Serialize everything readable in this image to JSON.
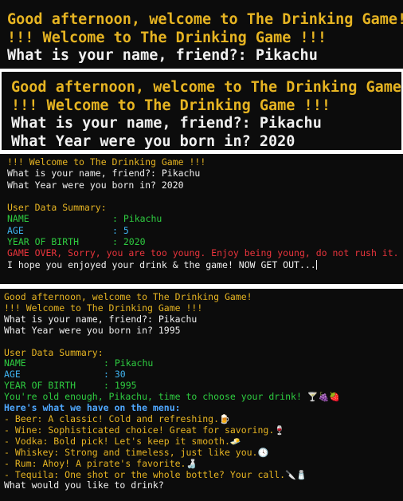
{
  "panel1": {
    "greeting": "Good afternoon, welcome to The Drinking Game!",
    "welcome": "!!! Welcome to The Drinking Game !!!",
    "name_prompt": "What is your name, friend?: Pikachu"
  },
  "panel2": {
    "greeting": "Good afternoon, welcome to The Drinking Game!",
    "welcome": "!!! Welcome to The Drinking Game !!!",
    "name_prompt": "What is your name, friend?: Pikachu",
    "year_prompt": "What Year were you born in? 2020"
  },
  "panel3": {
    "welcome": "!!! Welcome to The Drinking Game !!!",
    "name_prompt": "What is your name, friend?: Pikachu",
    "year_prompt": "What Year were you born in? 2020",
    "summary_title": "User Data Summary:",
    "name_label": "NAME",
    "name_value": ": Pikachu",
    "age_label": "AGE",
    "age_value": ": 5",
    "yob_label": "YEAR OF BIRTH",
    "yob_value": ": 2020",
    "game_over": "GAME OVER, Sorry, you are too young. Enjoy being young, do not rush it.",
    "goodbye": "I hope you enjoyed your drink & the game! NOW GET OUT..."
  },
  "panel4": {
    "greeting": "Good afternoon, welcome to The Drinking Game!",
    "welcome": "!!! Welcome to The Drinking Game !!!",
    "name_prompt": "What is your name, friend?: Pikachu",
    "year_prompt": "What Year were you born in? 1995",
    "summary_title": "User Data Summary:",
    "name_label": "NAME",
    "name_value": ": Pikachu",
    "age_label": "AGE",
    "age_value": ": 30",
    "yob_label": "YEAR OF BIRTH",
    "yob_value": ": 1995",
    "old_enough": "You're old enough, Pikachu, time to choose your drink!",
    "old_enough_emoji": "🍸🍇🍓",
    "menu_title": "Here's what we have on the menu:",
    "menu": [
      {
        "text": "- Beer: A classic! Cold and refreshing.",
        "emoji": "🍺"
      },
      {
        "text": "- Wine: Sophisticated choice! Great for savoring.",
        "emoji": "🍷"
      },
      {
        "text": "- Vodka: Bold pick! Let's keep it smooth.",
        "emoji": "🧈"
      },
      {
        "text": "- Whiskey: Strong and timeless, just like you.",
        "emoji": "🕓"
      },
      {
        "text": "- Rum: Ahoy! A pirate's favorite.",
        "emoji": "🍶"
      },
      {
        "text": "- Tequila: One shot or the whole bottle? Your call.",
        "emoji": "🔪🧂"
      }
    ],
    "drink_prompt": "What would you like to drink?"
  }
}
